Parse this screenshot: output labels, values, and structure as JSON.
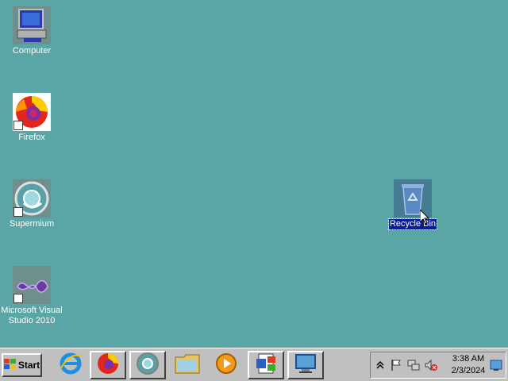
{
  "desktop": {
    "background_color": "#5aa6a6",
    "icons": [
      {
        "label": "Computer",
        "icon": "computer-icon",
        "shortcut": false,
        "selected": false
      },
      {
        "label": "Firefox",
        "icon": "firefox-icon",
        "shortcut": true,
        "selected": false
      },
      {
        "label": "Supermium",
        "icon": "supermium-icon",
        "shortcut": true,
        "selected": false
      },
      {
        "label": "Microsoft Visual Studio 2010",
        "icon": "visual-studio-icon",
        "shortcut": true,
        "selected": false
      },
      {
        "label": "Recycle Bin",
        "icon": "recycle-bin-icon",
        "shortcut": false,
        "selected": true
      }
    ]
  },
  "taskbar": {
    "start_label": "Start",
    "quick_launch": [
      "internet-explorer-icon",
      "firefox-icon",
      "supermium-icon",
      "file-explorer-icon",
      "media-player-icon",
      "word-document-icon",
      "remote-desktop-icon"
    ],
    "tray": {
      "icons": [
        "chevron-up-icon",
        "flag-icon",
        "network-icon",
        "volume-muted-icon",
        "show-desktop-icon"
      ],
      "time": "3:38 AM",
      "date": "2/3/2024"
    }
  }
}
